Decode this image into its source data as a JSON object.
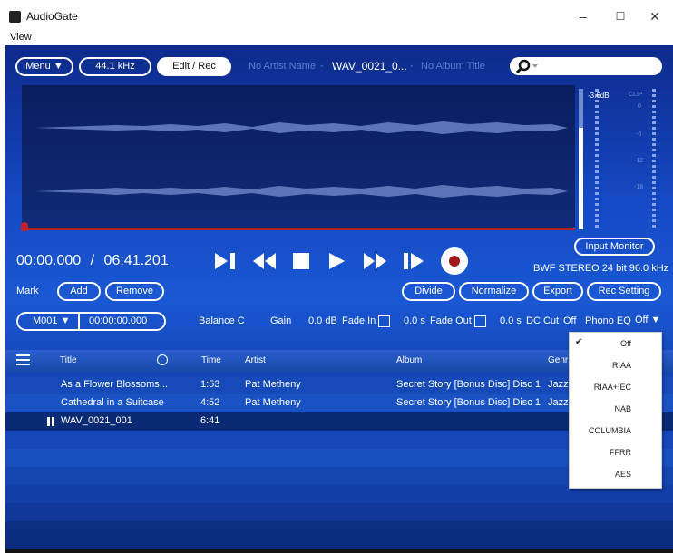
{
  "window": {
    "title": "AudioGate",
    "minimize": "–",
    "maximize": "☐",
    "close": "✕"
  },
  "menubar": {
    "view": "View"
  },
  "toolbar": {
    "menu": "Menu ▼",
    "samplerate": "44.1 kHz",
    "editrec": "Edit / Rec",
    "artist": "No Artist Name",
    "sep1": "·",
    "file": "WAV_0021_0...",
    "sep2": "·",
    "album": "No Album Title",
    "search_icon": "search-icon"
  },
  "meter": {
    "db": "-3.6dB",
    "clip": "CLIP",
    "ticks": [
      "0",
      "-6",
      "-12",
      "-18"
    ]
  },
  "transport": {
    "current": "00:00.000",
    "slash": "/",
    "total": "06:41.201",
    "input_monitor": "Input Monitor",
    "format": "BWF STEREO 24 bit 96.0 kHz",
    "level": 0.72
  },
  "mark": {
    "label": "Mark",
    "add": "Add",
    "remove": "Remove",
    "marker": "M001 ▼",
    "marker_time": "00:00:00.000"
  },
  "edit": {
    "divide": "Divide",
    "normalize": "Normalize",
    "export": "Export",
    "rec_setting": "Rec Setting"
  },
  "params": {
    "balance": "Balance C",
    "gain_label": "Gain",
    "gain_value": "0.0 dB",
    "fade_in": "Fade In",
    "fade_in_time": "0.0 s",
    "fade_out": "Fade Out",
    "fade_out_time": "0.0 s",
    "dc_cut": "DC Cut",
    "dc_cut_value": "Off",
    "phono_eq": "Phono EQ",
    "phono_eq_value": "Off ▼"
  },
  "table": {
    "headers": {
      "title": "Title",
      "time": "Time",
      "artist": "Artist",
      "album": "Album",
      "genre": "Genr"
    },
    "rows": [
      {
        "title": "As a Flower Blossoms...",
        "time": "1:53",
        "artist": "Pat Metheny",
        "album": "Secret Story [Bonus Disc] Disc 1",
        "genre": "Jazz"
      },
      {
        "title": "Cathedral in a Suitcase",
        "time": "4:52",
        "artist": "Pat Metheny",
        "album": "Secret Story [Bonus Disc] Disc 1",
        "genre": "Jazz"
      },
      {
        "title": "WAV_0021_001",
        "time": "6:41",
        "artist": "",
        "album": "",
        "genre": ""
      }
    ]
  },
  "phono_dropdown": {
    "selected": "Off",
    "options": [
      "Off",
      "RIAA",
      "RIAA+IEC",
      "NAB",
      "COLUMBIA",
      "FFRR",
      "AES"
    ]
  },
  "colors": {
    "accent": "#1a58d4",
    "rec": "#a01818",
    "selected_row": "#0b2a74"
  }
}
